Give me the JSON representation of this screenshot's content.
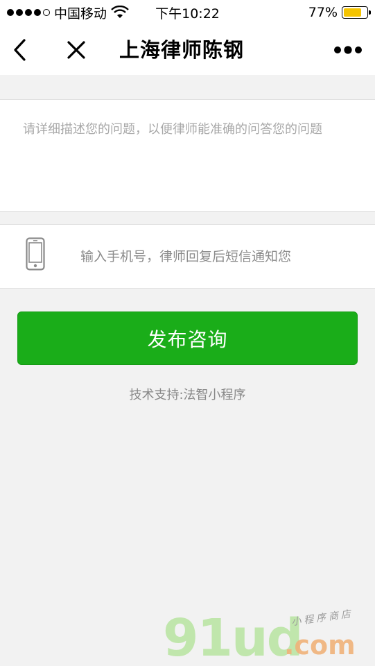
{
  "status_bar": {
    "carrier": "中国移动",
    "time": "下午10:22",
    "battery_percent": "77%",
    "battery_level": 0.77,
    "signal_bars_filled": 4,
    "signal_bars_total": 5
  },
  "nav": {
    "title": "上海律师陈钢",
    "back_icon": "chevron-left-icon",
    "close_icon": "close-icon",
    "more_icon": "more-dots-icon"
  },
  "form": {
    "question_placeholder": "请详细描述您的问题，以便律师能准确的问答您的问题",
    "question_value": "",
    "phone_placeholder": "输入手机号，律师回复后短信通知您",
    "phone_value": "",
    "submit_label": "发布咨询"
  },
  "footer": {
    "support_text": "技术支持:法智小程序"
  },
  "watermark": {
    "main": "91ud",
    "dotcom": ".com",
    "sub": "小程序商店"
  },
  "colors": {
    "accent": "#1aad19",
    "background": "#f2f2f2",
    "battery": "#f5c400"
  }
}
